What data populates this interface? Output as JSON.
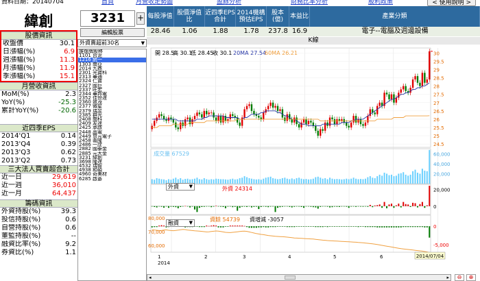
{
  "topbar": {
    "date_label": "資料日期：20140704",
    "home": "首頁",
    "links": [
      "月營收走勢圖",
      "盈餘分析",
      "財務比率分析",
      "股利政策"
    ],
    "help": "< 使用說明 >"
  },
  "stock": {
    "name": "緯創",
    "code": "3231",
    "plus": "+",
    "ctrl_btn": "編輯股票",
    "select": "外資賣超前30名"
  },
  "list": [
    "誰復牌股移",
    "1101 台泥",
    "1216 統一",
    "1303 南亞",
    "2014 九鼎",
    "2301 光寶科",
    "2313 華通",
    "2324 仁寶",
    "2327 國巨",
    "2337 旺宏",
    "2344 華邦電",
    "2352 佳世達",
    "2360 致茂",
    "2377 微星",
    "2379 瑞昱",
    "2385 群光",
    "2408 南科",
    "2409 友達",
    "2425 承啟",
    "2448 晶電",
    "2449 京元電子",
    "2458 義隆",
    "2486 一詮",
    "2882 國泰金",
    "2885 元大金",
    "3231 緯創",
    "3698 隆達",
    "4532 瑞智",
    "4938 和碩",
    "4960 奇美材",
    "6285 啟碁"
  ],
  "list_highlight": 2,
  "price": {
    "title": "股價資訊",
    "rows": [
      {
        "label": "收盤價",
        "value": "30.1",
        "cls": ""
      },
      {
        "label": "日漲幅(%)",
        "value": "6.9",
        "cls": "red"
      },
      {
        "label": "週漲幅(%)",
        "value": "11.3",
        "cls": "red"
      },
      {
        "label": "月漲幅(%)",
        "value": "11.9",
        "cls": "red"
      },
      {
        "label": "季漲幅(%)",
        "value": "15.1",
        "cls": "red"
      }
    ]
  },
  "revenue": {
    "title": "月營收資訊",
    "rows": [
      {
        "label": "MoM(%)",
        "value": "2.3",
        "cls": ""
      },
      {
        "label": "YoY(%)",
        "value": "-25.3",
        "cls": "green"
      },
      {
        "label": "累計YoY(%)",
        "value": "-20.6",
        "cls": "green"
      }
    ]
  },
  "eps": {
    "title": "近四季EPS",
    "rows": [
      {
        "label": "2014'Q1",
        "value": "0.14"
      },
      {
        "label": "2013'Q4",
        "value": "0.39"
      },
      {
        "label": "2013'Q3",
        "value": "0.62"
      },
      {
        "label": "2013'Q2",
        "value": "0.73"
      }
    ]
  },
  "inst": {
    "title": "三大法人買賣超合計",
    "rows": [
      {
        "label": "近一日",
        "value": "29,619",
        "cls": "red"
      },
      {
        "label": "近一週",
        "value": "36,010",
        "cls": "red"
      },
      {
        "label": "近一月",
        "value": "64,437",
        "cls": "red"
      }
    ]
  },
  "chips": {
    "title": "籌碼資訊",
    "rows": [
      {
        "label": "外資持股(%)",
        "value": "39.3"
      },
      {
        "label": "投信持股(%)",
        "value": "0.6"
      },
      {
        "label": "自營持股(%)",
        "value": "0.6"
      },
      {
        "label": "董監持股(%)",
        "value": "--"
      },
      {
        "label": "融資比率(%)",
        "value": "9.2"
      },
      {
        "label": "券資比(%)",
        "value": "1.1"
      }
    ]
  },
  "header": {
    "cols": [
      "每股淨值",
      "股價淨值比",
      "近四季EPS合計",
      "2014機構預估EPS",
      "股本(億)",
      "本益比",
      "產業分類"
    ],
    "values": [
      "28.46",
      "1.06",
      "1.88",
      "1.78",
      "237.8",
      "16.9",
      "電子--電腦及週邊設備"
    ]
  },
  "kline_title": "K線",
  "colors": {
    "up": "#e00000",
    "down": "#007a00",
    "ma20": "#2a3aa8",
    "ma60": "#f0a040",
    "vol": "#6ad0ff"
  },
  "chart_data": {
    "type": "candlestick",
    "info": {
      "open": "開 28.5",
      "high": "高 30.1",
      "low": "低 28.45",
      "close": "收 30.1",
      "ma20": "20MA 27.54",
      "ma60": "60MA 26.21"
    },
    "y_ticks": [
      "30",
      "29.5",
      "29",
      "28.5",
      "28",
      "27.5",
      "27",
      "26.5",
      "26",
      "25.5",
      "25",
      "24.5"
    ],
    "ylim": [
      24.3,
      30.3
    ],
    "x_ticks": [
      "1",
      "2",
      "3",
      "4",
      "5",
      "6"
    ],
    "x_year": "2014",
    "x_end_label": "2014/07/04",
    "closes": [
      25.6,
      25.9,
      26.1,
      26.3,
      26.2,
      26.0,
      25.9,
      26.1,
      26.0,
      25.8,
      25.5,
      25.4,
      25.8,
      25.6,
      26.0,
      26.1,
      25.7,
      26.0,
      26.2,
      26.4,
      26.3,
      26.1,
      26.5,
      26.3,
      26.4,
      26.4,
      26.1,
      25.9,
      26.2,
      25.8,
      26.2,
      25.9,
      26.0,
      26.3,
      26.2,
      26.1,
      25.8,
      25.6,
      26.1,
      26.6,
      26.8,
      26.9,
      26.5,
      26.3,
      26.2,
      26.1,
      26.0,
      26.4,
      26.6,
      26.8,
      27.0,
      26.7,
      26.8,
      26.5,
      26.6,
      26.1,
      25.9,
      26.3,
      26.0,
      25.8,
      26.1,
      25.7,
      25.5,
      25.8,
      26.0,
      25.7,
      25.9,
      25.8,
      25.6,
      25.3,
      25.0,
      25.4,
      25.3,
      25.8,
      25.6,
      26.1,
      26.0,
      25.7,
      26.0,
      25.9,
      26.0,
      25.8,
      25.6,
      25.5,
      25.8,
      26.2,
      25.8,
      26.0,
      25.7,
      25.6,
      25.8,
      26.2,
      26.6,
      26.4,
      26.3,
      26.8,
      27.0,
      26.8,
      27.6,
      27.5,
      27.2,
      27.5,
      27.0,
      27.3,
      27.6,
      27.8,
      28.0,
      27.7,
      27.6,
      27.9,
      28.4,
      28.6,
      28.2,
      28.0,
      28.8,
      28.2,
      28.4,
      30.1
    ],
    "ma20": [
      26.0,
      26.0,
      26.0,
      26.0,
      26.0,
      26.0,
      26.0,
      26.0,
      26.0,
      26.0,
      26.0,
      25.9,
      25.9,
      25.9,
      25.9,
      25.9,
      25.9,
      25.9,
      25.9,
      26.0,
      26.0,
      26.0,
      26.1,
      26.1,
      26.2,
      26.2,
      26.2,
      26.2,
      26.2,
      26.2,
      26.2,
      26.1,
      26.1,
      26.1,
      26.1,
      26.1,
      26.1,
      26.0,
      26.0,
      26.1,
      26.1,
      26.2,
      26.3,
      26.3,
      26.3,
      26.3,
      26.4,
      26.4,
      26.5,
      26.5,
      26.5,
      26.5,
      26.5,
      26.4,
      26.4,
      26.3,
      26.2,
      26.2,
      26.1,
      26.0,
      26.0,
      25.9,
      25.8,
      25.7,
      25.7,
      25.7,
      25.6,
      25.6,
      25.6,
      25.6,
      25.6,
      25.6,
      25.7,
      25.7,
      25.7,
      25.7,
      25.7,
      25.7,
      25.7,
      25.7,
      25.8,
      25.8,
      25.8,
      25.8,
      25.9,
      25.9,
      26.0,
      26.0,
      26.0,
      26.0,
      26.1,
      26.2,
      26.3,
      26.4,
      26.5,
      26.6,
      26.7,
      26.8,
      26.9,
      27.0,
      27.1,
      27.2,
      27.2,
      27.3,
      27.4,
      27.5,
      27.5,
      27.6,
      27.6,
      27.7,
      27.8,
      27.8,
      27.9,
      27.9,
      28.0,
      28.0,
      28.1,
      28.2
    ],
    "ma60": [
      25.5,
      25.5,
      25.5,
      25.6,
      25.6,
      25.6,
      25.6,
      25.6,
      25.6,
      25.7,
      25.7,
      25.7,
      25.7,
      25.7,
      25.7,
      25.7,
      25.8,
      25.8,
      25.8,
      25.8,
      25.8,
      25.8,
      25.8,
      25.9,
      25.9,
      25.9,
      25.9,
      25.9,
      25.9,
      25.9,
      25.9,
      25.9,
      25.9,
      25.9,
      25.9,
      25.9,
      26.0,
      26.0,
      26.0,
      26.0,
      26.0,
      26.0,
      26.0,
      26.0,
      26.0,
      26.0,
      26.0,
      26.0,
      26.0,
      26.0,
      26.0,
      26.0,
      26.0,
      26.0,
      26.0,
      26.0,
      26.0,
      26.0,
      26.0,
      26.0,
      26.0,
      26.0,
      26.0,
      26.0,
      26.0,
      26.0,
      26.0,
      26.0,
      26.0,
      26.0,
      26.0,
      25.9,
      25.9,
      25.9,
      25.9,
      25.9,
      25.9,
      25.9,
      25.9,
      25.9,
      25.9,
      25.9,
      25.9,
      25.9,
      25.9,
      25.9,
      25.9,
      25.9,
      25.9,
      25.9,
      25.9,
      25.9,
      25.9,
      25.9,
      25.9,
      26.0,
      26.0,
      26.0,
      26.0,
      26.0,
      26.0,
      26.0,
      26.1,
      26.1,
      26.1,
      26.1,
      26.1,
      26.2,
      26.2,
      26.2,
      26.2,
      26.2,
      26.2,
      26.2,
      26.2,
      26.2,
      26.2,
      26.21
    ],
    "volume": {
      "label": "成交量 67529",
      "ticks": [
        "60,000",
        "40,000",
        "20,000"
      ],
      "max": 70000,
      "values": [
        9000,
        8000,
        11000,
        10000,
        9000,
        8500,
        7000,
        9000,
        8000,
        10000,
        12000,
        9000,
        11000,
        8000,
        9500,
        10000,
        8500,
        9000,
        10000,
        12000,
        9000,
        8500,
        11000,
        9000,
        8000,
        9000,
        8500,
        10000,
        9500,
        9000,
        9000,
        8500,
        8000,
        9000,
        10000,
        8500,
        9000,
        11000,
        12000,
        15000,
        13000,
        11000,
        10000,
        9000,
        8500,
        9000,
        8000,
        10000,
        12000,
        13000,
        14000,
        11000,
        10000,
        9000,
        9500,
        11000,
        12000,
        10000,
        9000,
        10500,
        9000,
        11000,
        12000,
        10000,
        9000,
        9500,
        8500,
        9000,
        10000,
        13000,
        14000,
        12000,
        10000,
        11000,
        9000,
        12000,
        10000,
        9000,
        9500,
        9000,
        8500,
        9000,
        10000,
        9000,
        10000,
        12000,
        10000,
        9000,
        9500,
        9000,
        10000,
        13000,
        15000,
        12000,
        11000,
        15000,
        18000,
        16000,
        22000,
        20000,
        17000,
        18000,
        15000,
        16000,
        20000,
        21000,
        23000,
        18000,
        16000,
        18000,
        25000,
        28000,
        22000,
        20000,
        30000,
        26000,
        25000,
        67529
      ]
    },
    "foreign": {
      "select": "外資",
      "label": "外資 24314",
      "ticks": [
        "20,000",
        "0"
      ],
      "ylim": [
        -10000,
        26000
      ],
      "values": [
        -500,
        -1000,
        -1500,
        -300,
        -800,
        -1800,
        -500,
        -2000,
        -700,
        -900,
        -1200,
        -2500,
        -1000,
        -500,
        200,
        -300,
        -1500,
        -600,
        -4000,
        -7000,
        -2000,
        -1000,
        -800,
        -300,
        -500,
        -1200,
        -600,
        500,
        -400,
        -700,
        -1000,
        -2500,
        -600,
        -300,
        -1200,
        -800,
        -5500,
        -2000,
        -800,
        -600,
        -1000,
        -500,
        -1500,
        -900,
        -700,
        -3500,
        -1000,
        -500,
        -800,
        -1200,
        -600,
        -400,
        -7000,
        -2000,
        -1200,
        -800,
        -500,
        -300,
        -900,
        -1500,
        -800,
        -500,
        -600,
        -1000,
        -2000,
        -500,
        -300,
        -800,
        -1200,
        -1500,
        -3000,
        -900,
        -500,
        -400,
        -700,
        -1500,
        -1200,
        -600,
        -800,
        -1000,
        -400,
        -500,
        -700,
        -2000,
        -600,
        -500,
        -900,
        -400,
        -600,
        -700,
        -500,
        -800,
        1500,
        -1200,
        800,
        1200,
        2000,
        -2000,
        5000,
        -2500,
        2000,
        3000,
        -2000,
        1000,
        3000,
        -1500,
        5000,
        2500,
        2000,
        -1000,
        4000,
        3500,
        -1500,
        2500,
        5000,
        -2000,
        1000,
        24314
      ]
    },
    "margin": {
      "select": "融資",
      "label": "資餘 54739",
      "label2": "資增減 -3057",
      "ticks_left": [
        "80,000",
        "70,000",
        "60,000"
      ],
      "ticks_right": [
        "0",
        "-5,000"
      ],
      "ylim_bal": [
        55000,
        82000
      ],
      "ylim_chg": [
        -7000,
        3000
      ],
      "balance": [
        71500,
        71200,
        71000,
        70800,
        70900,
        71200,
        71300,
        71000,
        70800,
        70700,
        70900,
        71100,
        71400,
        71600,
        71500,
        71200,
        71000,
        70800,
        70600,
        70500,
        70400,
        70200,
        70000,
        69800,
        69900,
        70100,
        70300,
        70500,
        70400,
        70100,
        69800,
        69500,
        69400,
        69300,
        69500,
        69700,
        69900,
        70100,
        70300,
        70400,
        70200,
        69800,
        69400,
        69000,
        68600,
        68300,
        68000,
        67800,
        67500,
        67200,
        67000,
        66800,
        66600,
        66500,
        66400,
        66300,
        66200,
        66000,
        65800,
        65600,
        65400,
        65300,
        65200,
        65100,
        65000,
        64900,
        64800,
        64700,
        64600,
        64400,
        64200,
        64000,
        63800,
        63700,
        63500,
        63400,
        63300,
        63200,
        63100,
        63000,
        62900,
        62800,
        62700,
        62600,
        62500,
        62400,
        62300,
        62100,
        62000,
        61900,
        61700,
        61500,
        61300,
        61100,
        60900,
        60600,
        60300,
        60000,
        59700,
        59400,
        59100,
        58800,
        58500,
        58200,
        57900,
        57600,
        57400,
        57200,
        57000,
        56800,
        56600,
        56400,
        56200,
        56000,
        55800,
        55500,
        55200,
        54739
      ],
      "change": [
        -300,
        -200,
        -200,
        200,
        300,
        200,
        -300,
        -200,
        -100,
        200,
        300,
        400,
        500,
        200,
        -300,
        -200,
        -200,
        -200,
        -100,
        -100,
        -200,
        -200,
        -200,
        200,
        100,
        200,
        300,
        200,
        -300,
        -300,
        -300,
        -100,
        -100,
        200,
        200,
        200,
        200,
        200,
        200,
        100,
        -200,
        -400,
        -400,
        -400,
        -400,
        -300,
        -300,
        -200,
        -300,
        -300,
        -200,
        -200,
        -200,
        -100,
        -100,
        -100,
        -100,
        -200,
        -200,
        -200,
        -200,
        -100,
        -100,
        -100,
        -100,
        -100,
        -100,
        -100,
        -100,
        -200,
        -200,
        -200,
        -200,
        -100,
        -200,
        -100,
        -100,
        -100,
        -100,
        -100,
        -100,
        -100,
        -100,
        -100,
        -100,
        -100,
        -100,
        -200,
        -100,
        -100,
        -200,
        -200,
        -200,
        -200,
        -200,
        -300,
        -300,
        -300,
        -300,
        -300,
        -300,
        -300,
        -300,
        -300,
        -300,
        -300,
        -200,
        -200,
        -200,
        -200,
        -200,
        -200,
        -200,
        -200,
        -200,
        -300,
        -300,
        -3057
      ]
    }
  }
}
